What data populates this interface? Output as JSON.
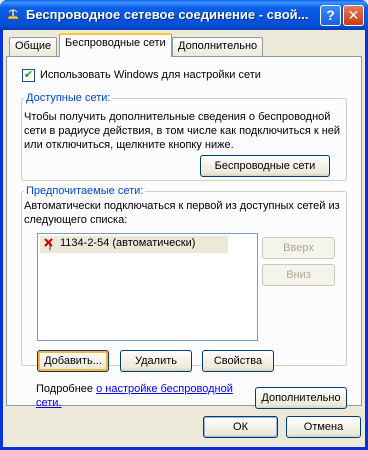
{
  "window": {
    "title": "Беспроводное сетевое соединение - свой...",
    "help_label": "?",
    "close_label": "✕"
  },
  "tabs": [
    {
      "label": "Общие",
      "active": false
    },
    {
      "label": "Беспроводные сети",
      "active": true
    },
    {
      "label": "Дополнительно",
      "active": false
    }
  ],
  "use_windows": {
    "label": "Использовать Windows для настройки сети",
    "checked": true,
    "check_glyph": "✔"
  },
  "available": {
    "title": "Доступные сети:",
    "text": "Чтобы получить дополнительные сведения о беспроводной сети в радиусе действия, в том числе как подключиться к ней или отключиться, щелкните кнопку ниже.",
    "button": "Беспроводные сети"
  },
  "preferred": {
    "title": "Предпочитаемые сети:",
    "text": "Автоматически подключаться к первой из доступных сетей из следующего списка:",
    "items": [
      {
        "label": "1134-2-54 (автоматически)",
        "icon": "wireless-network-disconnected-icon"
      }
    ],
    "up_button": "Вверх",
    "down_button": "Вниз",
    "add_button": "Добавить...",
    "remove_button": "Удалить",
    "props_button": "Свойства"
  },
  "more": {
    "prefix": "Подробнее ",
    "link": "о настройке беспроводной сети.",
    "button": "Дополнительно"
  },
  "footer": {
    "ok": "ОК",
    "cancel": "Отмена"
  }
}
